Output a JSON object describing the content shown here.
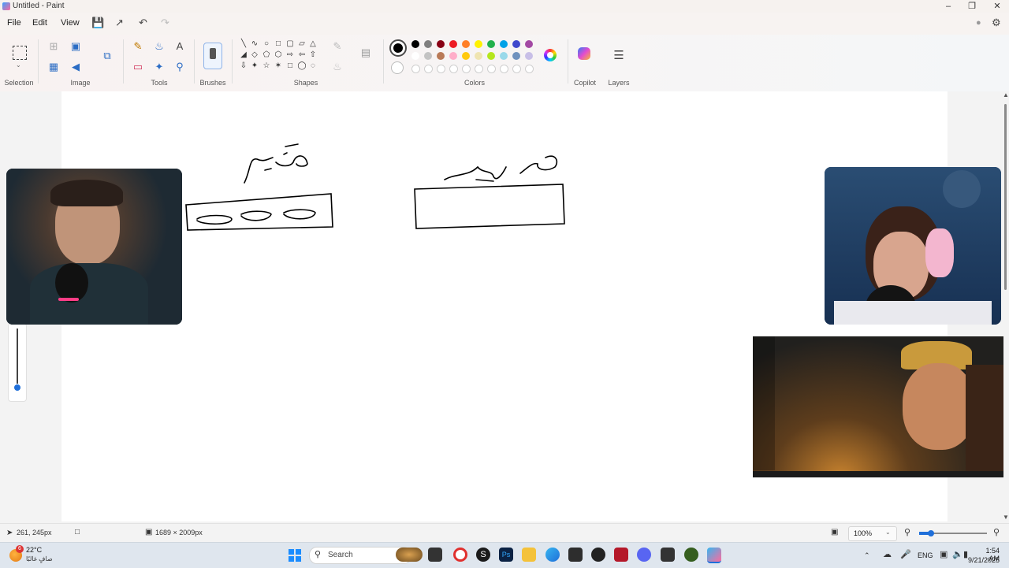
{
  "window": {
    "title": "Untitled - Paint"
  },
  "menu": {
    "file": "File",
    "edit": "Edit",
    "view": "View"
  },
  "ribbon": {
    "groups": {
      "selection": "Selection",
      "image": "Image",
      "tools": "Tools",
      "brushes": "Brushes",
      "shapes": "Shapes",
      "colors": "Colors",
      "copilot": "Copilot",
      "layers": "Layers"
    },
    "palette_row1": [
      "#000000",
      "#7f7f7f",
      "#880015",
      "#ed1c24",
      "#ff7f27",
      "#fff200",
      "#22b14c",
      "#00a2e8",
      "#3f48cc",
      "#a349a4"
    ],
    "palette_row2": [
      "#ffffff",
      "#c3c3c3",
      "#b97a57",
      "#ffaec9",
      "#ffc90e",
      "#efe4b0",
      "#b5e61d",
      "#99d9ea",
      "#7092be",
      "#c8bfe7"
    ],
    "primary_color": "#000000",
    "secondary_color": "#ffffff"
  },
  "canvas": {
    "drawings": [
      {
        "label": "drawn-word-left",
        "text": "قديم"
      },
      {
        "label": "drawn-word-right",
        "text": "جديد"
      }
    ]
  },
  "status": {
    "cursor_pos": "261, 245px",
    "canvas_size": "1689 × 2009px",
    "zoom": "100%"
  },
  "taskbar": {
    "weather_temp": "22°C",
    "weather_desc": "صافٍ غالبًا",
    "weather_badge": "6",
    "search_placeholder": "Search",
    "lang": "ENG",
    "time": "1:54 AM",
    "date": "9/21/2025"
  }
}
